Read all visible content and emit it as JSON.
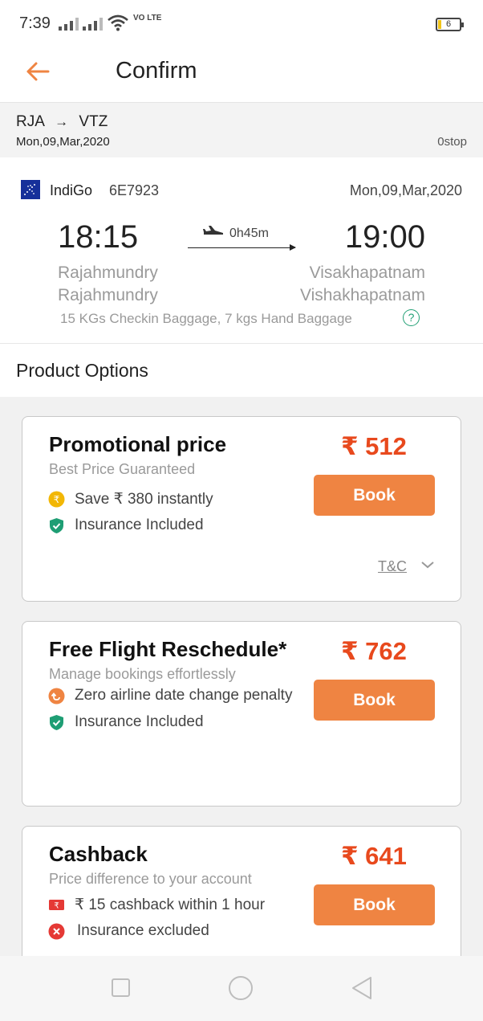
{
  "status_bar": {
    "time": "7:39",
    "network": "VO LTE",
    "battery": "6"
  },
  "header": {
    "title": "Confirm"
  },
  "route": {
    "from": "RJA",
    "arrow": "→",
    "to": "VTZ",
    "date": "Mon,09,Mar,2020",
    "stops": "0stop"
  },
  "flight": {
    "airline": "IndiGo",
    "flight_number": "6E7923",
    "date": "Mon,09,Mar,2020",
    "departure_time": "18:15",
    "arrival_time": "19:00",
    "duration": "0h45m",
    "departure_city": "Rajahmundry",
    "departure_airport": "Rajahmundry",
    "arrival_city": "Visakhapatnam",
    "arrival_airport": "Vishakhapatnam",
    "baggage": "15 KGs Checkin Baggage, 7 kgs Hand Baggage",
    "help": "?"
  },
  "options_title": "Product Options",
  "options": [
    {
      "title": "Promotional price",
      "subtitle": "Best Price Guaranteed",
      "price": "₹ 512",
      "button": "Book",
      "features": [
        {
          "icon": "rupee-coin-icon",
          "text": "Save ₹ 380 instantly"
        },
        {
          "icon": "shield-check-icon",
          "text": "Insurance Included"
        }
      ],
      "tnc": "T&C"
    },
    {
      "title": "Free Flight Reschedule*",
      "subtitle": "Manage bookings effortlessly",
      "price": "₹ 762",
      "button": "Book",
      "features": [
        {
          "icon": "reschedule-icon",
          "text": "Zero airline date change penalty"
        },
        {
          "icon": "shield-check-icon",
          "text": "Insurance Included"
        }
      ]
    },
    {
      "title": "Cashback",
      "subtitle": "Price difference to your account",
      "price": "₹ 641",
      "button": "Book",
      "features": [
        {
          "icon": "cash-note-icon",
          "text": "₹ 15 cashback within 1 hour"
        },
        {
          "icon": "cross-circle-icon",
          "text": "Insurance excluded"
        }
      ]
    }
  ],
  "colors": {
    "accent": "#ef8442",
    "price": "#e8491d",
    "success": "#22a075",
    "error": "#e53935",
    "airline": "#16309a"
  }
}
